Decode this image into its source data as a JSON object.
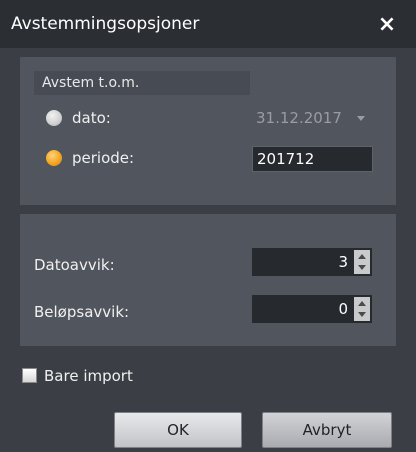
{
  "dialog": {
    "title": "Avstemmingsopsjoner",
    "close_glyph": "×"
  },
  "group": {
    "title": "Avstem t.o.m.",
    "options": [
      {
        "label": "dato:",
        "checked": false
      },
      {
        "label": "periode:",
        "checked": true
      }
    ],
    "date_value": "31.12.2017",
    "period_value": "201712"
  },
  "deviations": {
    "date_label": "Datoavvik:",
    "date_value": "3",
    "amount_label": "Beløpsavvik:",
    "amount_value": "0"
  },
  "bare_import": {
    "label": "Bare import",
    "checked": false
  },
  "buttons": {
    "ok": "OK",
    "cancel": "Avbryt"
  },
  "colors": {
    "accent_radio": "#f2a623",
    "window_bg": "#3b3e45",
    "panel_bg": "#51555e"
  }
}
